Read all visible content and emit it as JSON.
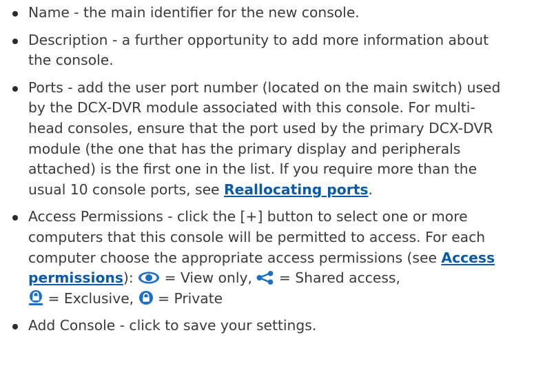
{
  "items": [
    {
      "text": "Name - the main identifier for the new console."
    },
    {
      "text": "Description - a further opportunity to add more information about the console."
    },
    {
      "text": "Ports - add the user port number (located on the main switch) used by the DCX-DVR module associated with this console. For multi-head consoles, ensure that the port used by the primary DCX-DVR module (the one that has the primary display and peripherals attached) is the first one in the list. If you require more than the usual 10 console ports, see ",
      "link": "Reallocating ports",
      "after": "."
    },
    {
      "text": "Access Permissions - click the [+] button to select one or more computers that this console will be permitted to access. For each computer choose the appropriate access permissions (see ",
      "link": "Access permissions",
      "after_link": "): ",
      "view_label": " = View only, ",
      "shared_label": " = Shared access,",
      "exclusive_label": " = Exclusive, ",
      "private_label": " = Private",
      "icons": [
        "eye-icon",
        "share-icon",
        "exclusive-lock-icon",
        "private-lock-icon"
      ]
    },
    {
      "text": "Add Console - click to save your settings."
    }
  ],
  "colors": {
    "link": "#0b5aa8",
    "icon": "#1a6fc9",
    "text": "#3a3a3a"
  }
}
